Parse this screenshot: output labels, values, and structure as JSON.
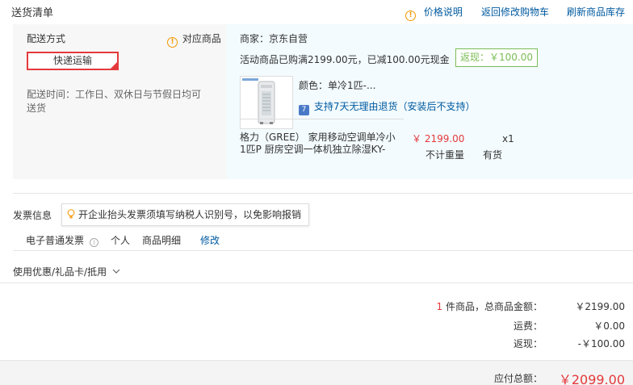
{
  "header": {
    "title": "送货清单",
    "price_desc": "价格说明",
    "back_to_cart": "返回修改购物车",
    "refresh_stock": "刷新商品库存"
  },
  "delivery": {
    "method_label": "配送方式",
    "related_goods": "对应商品",
    "express": "快递运输",
    "time_line1": "配送时间：工作日、双休日与节假日均可",
    "time_line2": "送货"
  },
  "merchant": {
    "name": "商家：京东自营",
    "promo": "活动商品已购满2199.00元，已减100.00元现金",
    "cashback_badge": "返现：￥100.00"
  },
  "product": {
    "color": "颜色：单冷1匹-...",
    "return_policy": "支持7天无理由退货（安装后不支持）",
    "seven_icon": "7",
    "name_line1": "格力（GREE） 家用移动空调单冷小",
    "name_line2": "1匹P 厨房空调一体机独立除湿KY-",
    "price": "￥ 2199.00",
    "weight": "不计重量",
    "quantity": "x1",
    "stock": "有货"
  },
  "invoice": {
    "label": "发票信息",
    "tip": "开企业抬头发票须填写纳税人识别号，以免影响报销",
    "type": "电子普通发票",
    "title": "个人",
    "content": "商品明细",
    "edit": "修改"
  },
  "coupon": {
    "label": "使用优惠/礼品卡/抵用"
  },
  "summary": {
    "count": "1",
    "count_label": "件商品，总商品金额：",
    "goods_total": "￥2199.00",
    "shipping_label": "运费：",
    "shipping": "￥0.00",
    "cashback_label": "返现：",
    "cashback": "-￥100.00",
    "payable_label": "应付总额：",
    "payable": "￥2099.00"
  },
  "colors": {
    "accent_red": "#e4393c",
    "link_blue": "#005aa0",
    "cashback_green": "#7abd54",
    "warning_orange": "#f39800"
  },
  "icons": {
    "warning": "warning-circle-icon",
    "bulb": "lightbulb-icon",
    "info": "info-icon",
    "chevron": "chevron-down-icon"
  }
}
